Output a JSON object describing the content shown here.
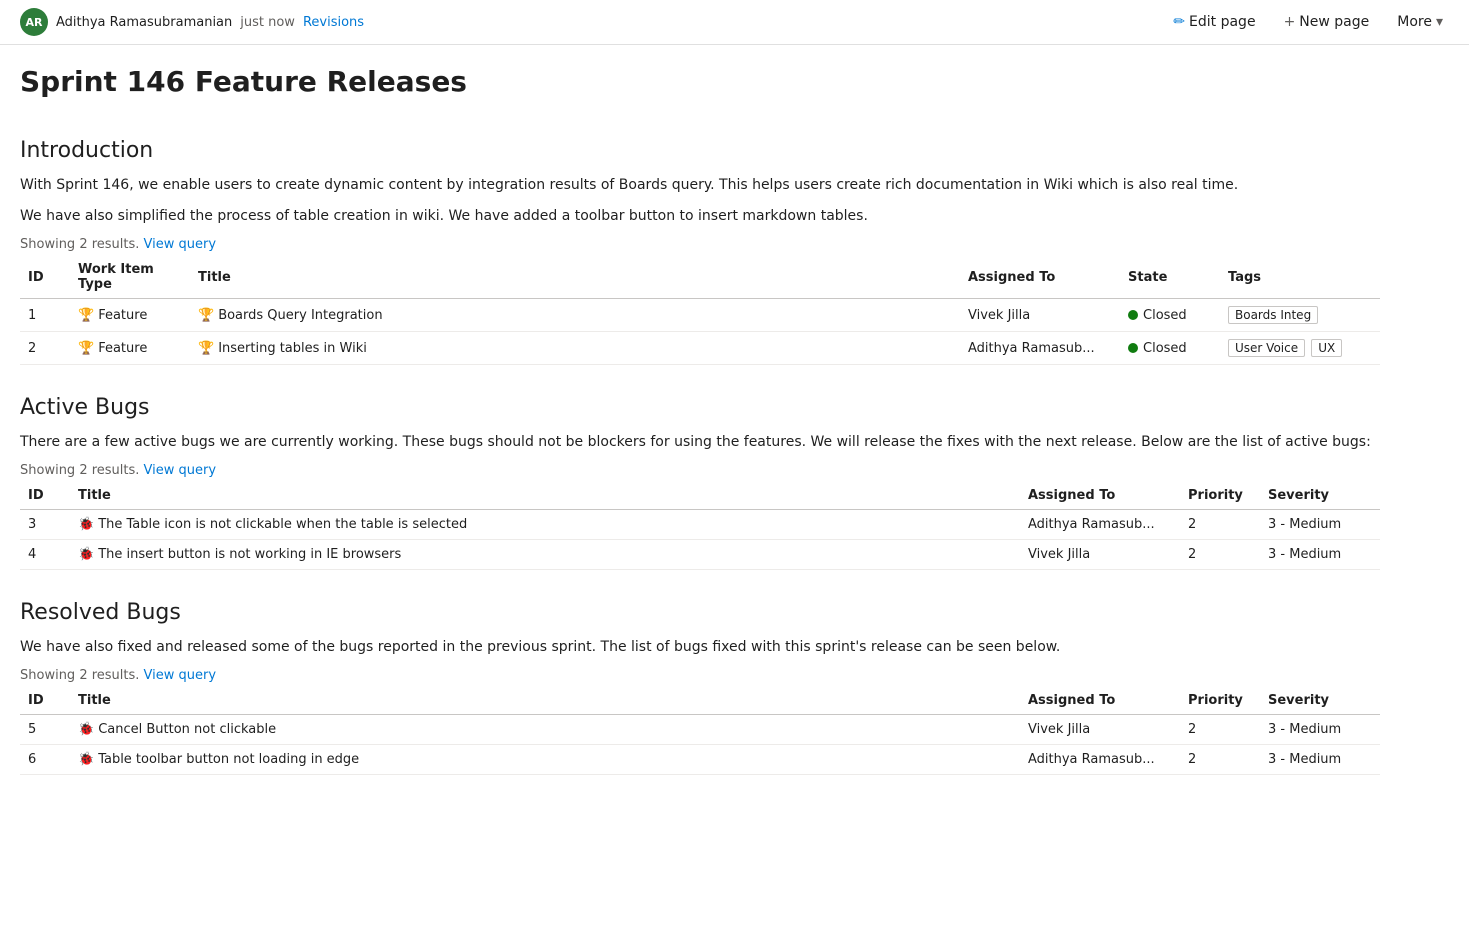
{
  "header": {
    "author_initials": "AR",
    "author_name": "Adithya Ramasubramanian",
    "timestamp": "just now",
    "revisions_label": "Revisions",
    "edit_page_label": "Edit page",
    "new_page_label": "New page",
    "more_label": "More"
  },
  "page": {
    "title": "Sprint 146 Feature Releases"
  },
  "introduction": {
    "section_title": "Introduction",
    "paragraphs": [
      "With Sprint 146, we enable users to create dynamic content by integration results of Boards query. This helps users create rich documentation in Wiki which is also real time.",
      "We have also simplified the process of table creation in wiki. We have added a toolbar button to insert markdown tables."
    ],
    "showing_results": "Showing 2 results.",
    "view_query_label": "View query",
    "table": {
      "columns": [
        "ID",
        "Work Item Type",
        "Title",
        "Assigned To",
        "State",
        "Tags"
      ],
      "rows": [
        {
          "id": "1",
          "type": "Feature",
          "title": "Boards Query Integration",
          "assigned_to": "Vivek Jilla",
          "state": "Closed",
          "tags": [
            "Boards Integ"
          ]
        },
        {
          "id": "2",
          "type": "Feature",
          "title": "Inserting tables in Wiki",
          "assigned_to": "Adithya Ramasub...",
          "state": "Closed",
          "tags": [
            "User Voice",
            "UX"
          ]
        }
      ]
    }
  },
  "active_bugs": {
    "section_title": "Active Bugs",
    "paragraph": "There are a few active bugs we are currently working. These bugs should not be blockers for using the features. We will release the fixes with the next release. Below are the list of active bugs:",
    "showing_results": "Showing 2 results.",
    "view_query_label": "View query",
    "table": {
      "columns": [
        "ID",
        "Title",
        "Assigned To",
        "Priority",
        "Severity"
      ],
      "rows": [
        {
          "id": "3",
          "title": "The Table icon is not clickable when the table is selected",
          "assigned_to": "Adithya Ramasub...",
          "priority": "2",
          "severity": "3 - Medium"
        },
        {
          "id": "4",
          "title": "The insert button is not working in IE browsers",
          "assigned_to": "Vivek Jilla",
          "priority": "2",
          "severity": "3 - Medium"
        }
      ]
    }
  },
  "resolved_bugs": {
    "section_title": "Resolved Bugs",
    "paragraph": "We have also fixed and released some of the bugs reported in the previous sprint. The list of bugs fixed with this sprint's release can be seen below.",
    "showing_results": "Showing 2 results.",
    "view_query_label": "View query",
    "table": {
      "columns": [
        "ID",
        "Title",
        "Assigned To",
        "Priority",
        "Severity"
      ],
      "rows": [
        {
          "id": "5",
          "title": "Cancel Button not clickable",
          "assigned_to": "Vivek Jilla",
          "priority": "2",
          "severity": "3 - Medium"
        },
        {
          "id": "6",
          "title": "Table toolbar button not loading in edge",
          "assigned_to": "Adithya Ramasub...",
          "priority": "2",
          "severity": "3 - Medium"
        }
      ]
    }
  }
}
